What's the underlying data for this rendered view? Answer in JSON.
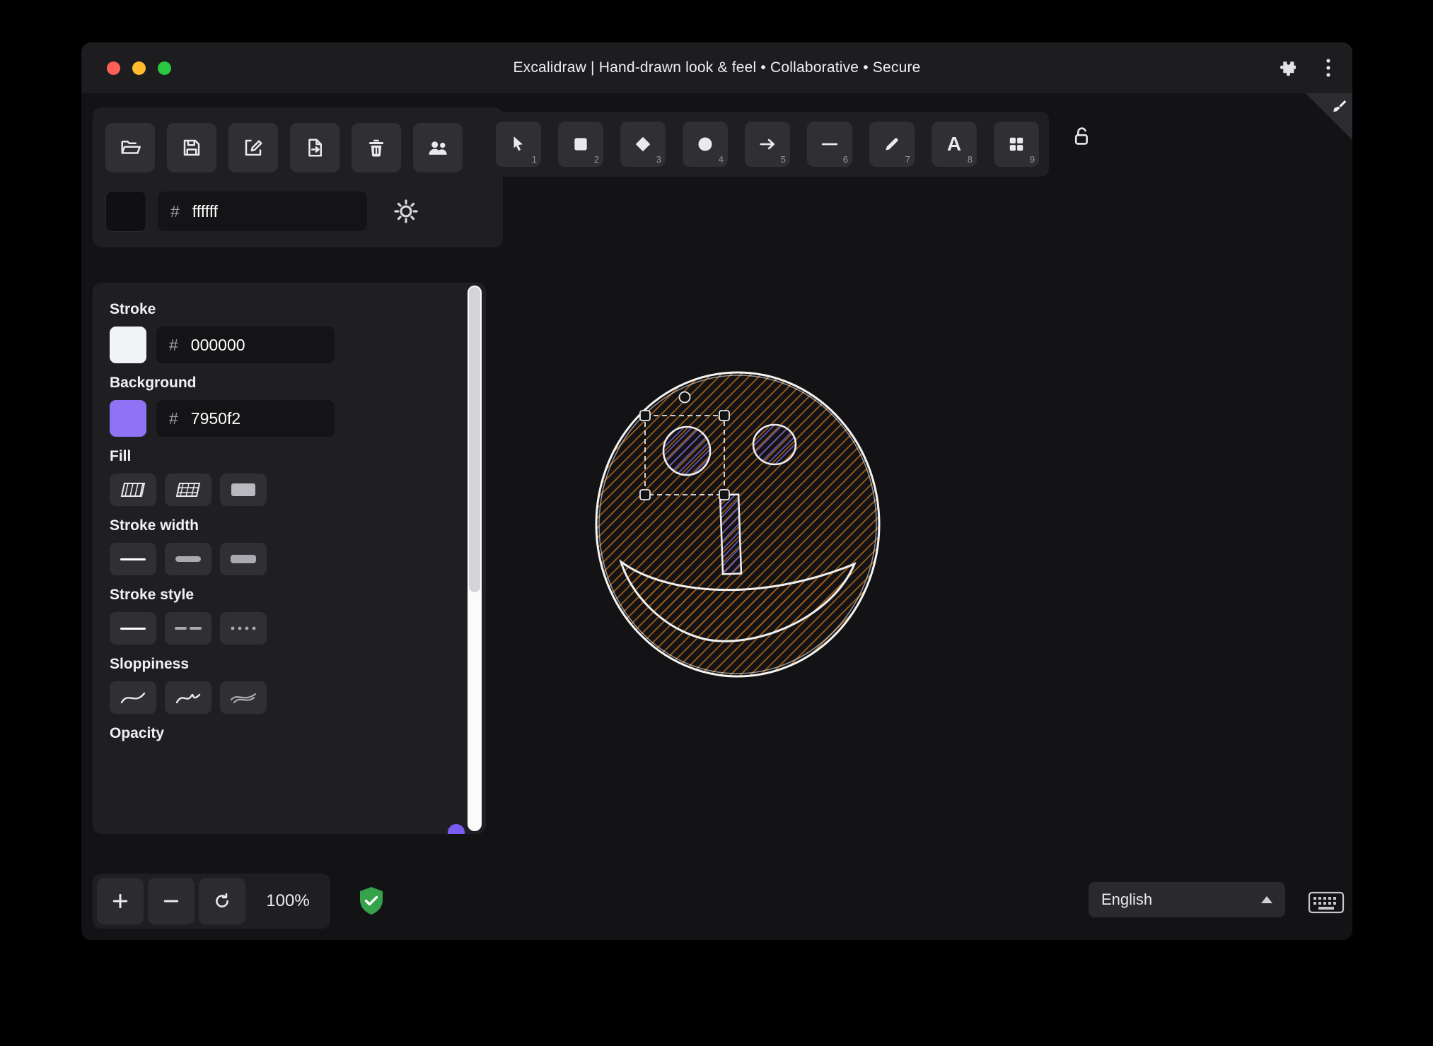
{
  "titlebar": {
    "title": "Excalidraw | Hand-drawn look & feel • Collaborative • Secure"
  },
  "file_toolbar": {
    "icons": [
      "open-folder",
      "save",
      "save-as",
      "export-file",
      "trash",
      "collaborators"
    ]
  },
  "canvas_bg": {
    "hash": "#",
    "value": "ffffff"
  },
  "stroke": {
    "label": "Stroke",
    "hash": "#",
    "value": "000000"
  },
  "background": {
    "label": "Background",
    "hash": "#",
    "value": "7950f2"
  },
  "sections": {
    "fill": "Fill",
    "stroke_width": "Stroke width",
    "stroke_style": "Stroke style",
    "sloppiness": "Sloppiness",
    "opacity": "Opacity"
  },
  "tools": [
    {
      "name": "selection",
      "shortcut": "1"
    },
    {
      "name": "rectangle",
      "shortcut": "2"
    },
    {
      "name": "diamond",
      "shortcut": "3"
    },
    {
      "name": "ellipse",
      "shortcut": "4"
    },
    {
      "name": "arrow",
      "shortcut": "5"
    },
    {
      "name": "line",
      "shortcut": "6"
    },
    {
      "name": "draw",
      "shortcut": "7"
    },
    {
      "name": "text",
      "shortcut": "8",
      "glyph": "A"
    },
    {
      "name": "shapes",
      "shortcut": "9"
    }
  ],
  "zoom": {
    "level": "100%"
  },
  "language": {
    "selected": "English"
  },
  "colors": {
    "accent": "#7950f2",
    "background_swatch": "#8f72f5",
    "stroke_swatch": "#f1f3f5",
    "face_hachure": "#a35f17",
    "shape_hachure": "#6f62d8",
    "shield_green": "#36a34a"
  }
}
